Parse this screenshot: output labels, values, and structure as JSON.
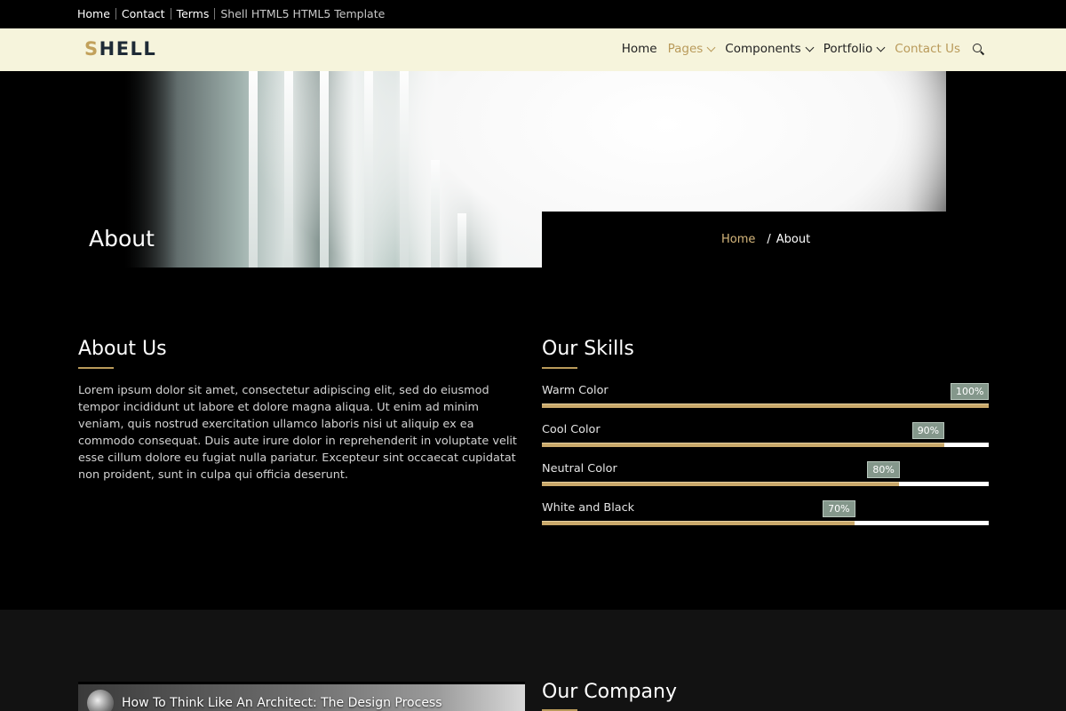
{
  "topbar": {
    "links": [
      "Home",
      "Contact",
      "Terms"
    ],
    "template_text": "Shell HTML5 HTML5 Template"
  },
  "navbar": {
    "logo_first": "S",
    "logo_rest": "HELL",
    "items": [
      {
        "label": "Home"
      },
      {
        "label": "Pages"
      },
      {
        "label": "Components"
      },
      {
        "label": "Portfolio"
      },
      {
        "label": "Contact Us"
      }
    ]
  },
  "hero": {
    "title": "About",
    "breadcrumb": {
      "home": "Home",
      "separator": "/",
      "current": "About"
    }
  },
  "about": {
    "heading": "About Us",
    "text": "Lorem ipsum dolor sit amet, consectetur adipiscing elit, sed do eiusmod tempor incididunt ut labore et dolore magna aliqua. Ut enim ad minim veniam, quis nostrud exercitation ullamco laboris nisi ut aliquip ex ea commodo consequat. Duis aute irure dolor in reprehenderit in voluptate velit esse cillum dolore eu fugiat nulla pariatur. Excepteur sint occaecat cupidatat non proident, sunt in culpa qui officia deserunt."
  },
  "skills": {
    "heading": "Our Skills",
    "items": [
      {
        "label": "Warm Color",
        "percent": 100,
        "percent_text": "100%"
      },
      {
        "label": "Cool Color",
        "percent": 90,
        "percent_text": "90%"
      },
      {
        "label": "Neutral Color",
        "percent": 80,
        "percent_text": "80%"
      },
      {
        "label": "White and Black",
        "percent": 70,
        "percent_text": "70%"
      }
    ]
  },
  "company": {
    "heading": "Our Company",
    "video_title": "How To Think Like An Architect: The Design Process"
  },
  "colors": {
    "accent_gold": "#b99a5a",
    "navbar_bg": "#f6f4dc",
    "badge_bg": "#84978b"
  }
}
